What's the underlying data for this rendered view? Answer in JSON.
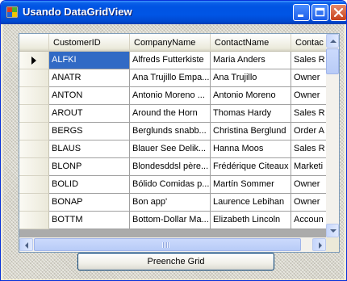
{
  "window": {
    "title": "Usando DataGridView"
  },
  "grid": {
    "columns": [
      "CustomerID",
      "CompanyName",
      "ContactName",
      "Contac"
    ],
    "rows": [
      [
        "ALFKI",
        "Alfreds Futterkiste",
        "Maria Anders",
        "Sales R"
      ],
      [
        "ANATR",
        "Ana Trujillo Empa...",
        "Ana Trujillo",
        "Owner"
      ],
      [
        "ANTON",
        "Antonio Moreno ...",
        "Antonio Moreno",
        "Owner"
      ],
      [
        "AROUT",
        "Around the Horn",
        "Thomas Hardy",
        "Sales R"
      ],
      [
        "BERGS",
        "Berglunds snabb...",
        "Christina Berglund",
        "Order A"
      ],
      [
        "BLAUS",
        "Blauer See Delik...",
        "Hanna Moos",
        "Sales R"
      ],
      [
        "BLONP",
        "Blondesddsl père...",
        "Frédérique Citeaux",
        "Marketi"
      ],
      [
        "BOLID",
        "Bólido Comidas p...",
        "Martín Sommer",
        "Owner"
      ],
      [
        "BONAP",
        "Bon app'",
        "Laurence Lebihan",
        "Owner"
      ],
      [
        "BOTTM",
        "Bottom-Dollar Ma...",
        "Elizabeth Lincoln",
        "Accoun"
      ]
    ],
    "selected_row": 0
  },
  "buttons": {
    "fill": "Preenche Grid"
  },
  "colors": {
    "titlebar": "#0054e3",
    "selection": "#316ac5",
    "close_button": "#c6411c"
  }
}
